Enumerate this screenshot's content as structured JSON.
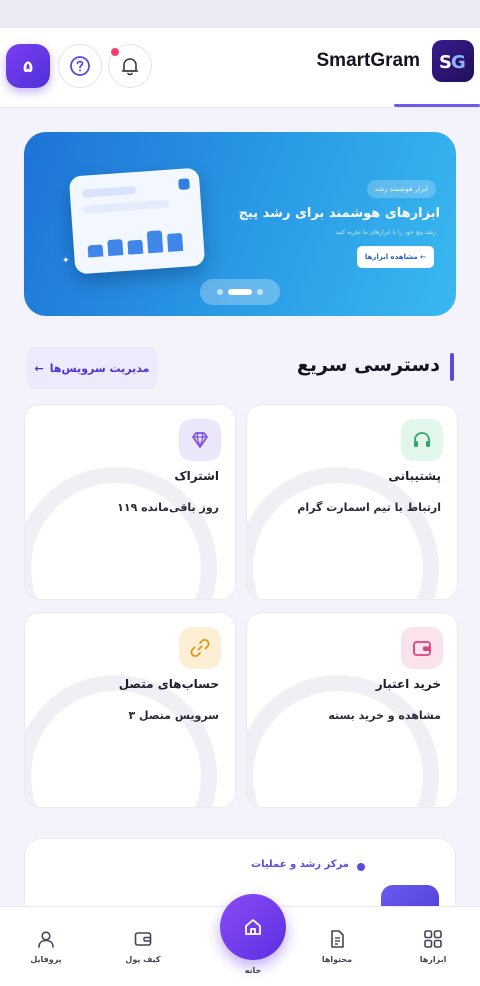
{
  "header": {
    "brand": "SmartGram",
    "credit_badge": "۵",
    "notification_count": 1
  },
  "banner": {
    "tag": "ابزار هوشمند رشد",
    "title": "ابزارهای هوشمند برای رشد پیج",
    "subtitle": "رشد پیج خود را با ابزارهای ما تجربه کنید",
    "cta": "مشاهده ابزارها ←",
    "slide_count": 3,
    "active_slide": 2
  },
  "quick_access": {
    "title": "دسترسی سریع",
    "manage_label": "مدیریت سرویس‌ها",
    "manage_arrow": "←",
    "cards": [
      {
        "title": "پشتیبانی",
        "subtitle": "ارتباط با تیم اسمارت گرام",
        "icon": "headset-icon",
        "color": "#e3f6ea",
        "icon_color": "#2fa866"
      },
      {
        "title": "اشتراک",
        "subtitle": "۱۱۹ روز باقی‌مانده",
        "icon": "diamond-icon",
        "color": "#ece6fb",
        "icon_color": "#7b4fe0"
      },
      {
        "title": "خرید اعتبار",
        "subtitle": "مشاهده و خرید بسته",
        "icon": "wallet-icon",
        "color": "#fbe3ee",
        "icon_color": "#d9437e"
      },
      {
        "title": "حساب‌های متصل",
        "subtitle": "۳ سرویس متصل",
        "icon": "link-icon",
        "color": "#fcefd4",
        "icon_color": "#d99a1e"
      }
    ]
  },
  "growth_center": {
    "label": "مرکز رشد و عملیات"
  },
  "bottom_nav": {
    "tools": "ابزارها",
    "content": "محتواها",
    "home": "خانه",
    "wallet": "کیف پول",
    "profile": "پروفایل"
  },
  "colors": {
    "accent": "#5b4ae0",
    "banner_start": "#1e73d6",
    "banner_end": "#3ab8f0"
  }
}
